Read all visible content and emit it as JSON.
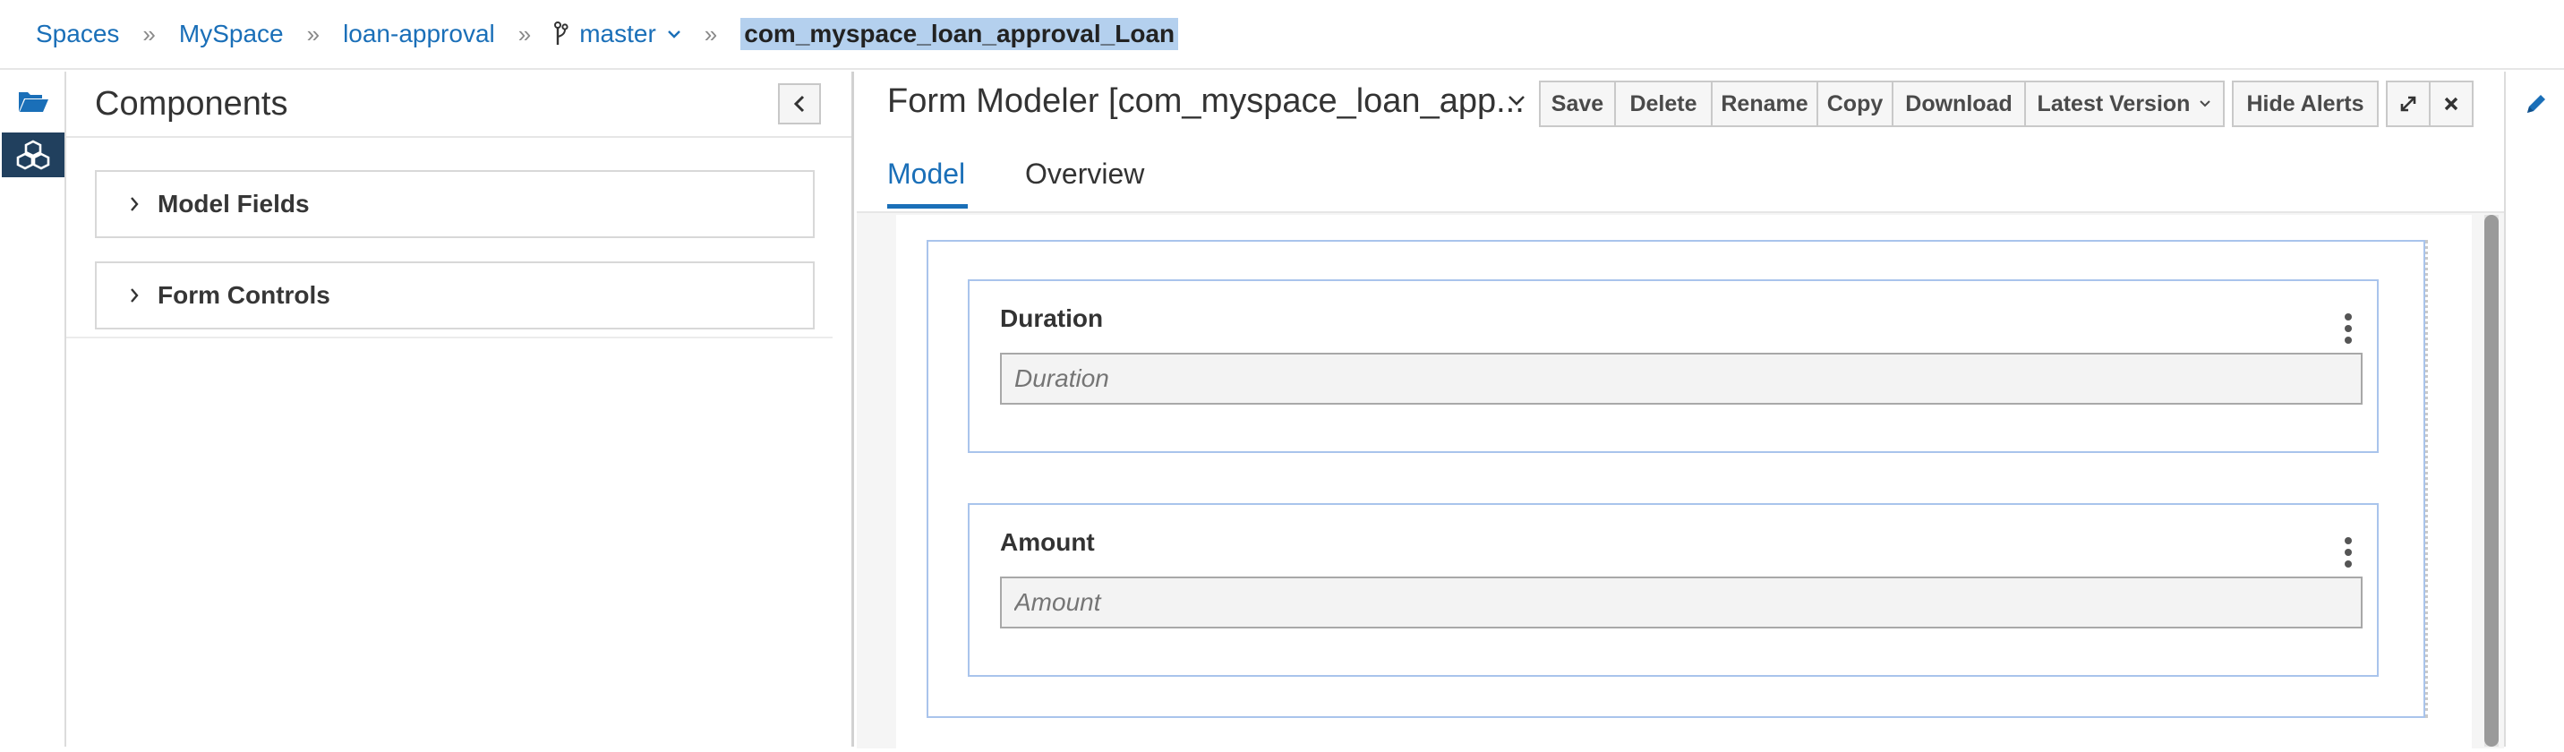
{
  "breadcrumb": {
    "spaces": "Spaces",
    "myspace": "MySpace",
    "project": "loan-approval",
    "branch": "master",
    "current": "com_myspace_loan_approval_Loan"
  },
  "rail": {
    "projects_icon": "folder-open-icon",
    "components_icon": "cubes-icon"
  },
  "components": {
    "title": "Components",
    "sections": [
      "Model Fields",
      "Form Controls"
    ]
  },
  "editor": {
    "title": "Form Modeler [com_myspace_loan_app...",
    "toolbar": {
      "save": "Save",
      "delete": "Delete",
      "rename": "Rename",
      "copy": "Copy",
      "download": "Download",
      "latest_version": "Latest Version",
      "hide_alerts": "Hide Alerts"
    },
    "tabs": [
      "Model",
      "Overview"
    ],
    "active_tab": "Model"
  },
  "form": {
    "fields": [
      {
        "label": "Duration",
        "placeholder": "Duration"
      },
      {
        "label": "Amount",
        "placeholder": "Amount"
      }
    ]
  },
  "colors": {
    "link": "#1a6fb8",
    "rail_active": "#21405e",
    "field_outline": "#a9c4ec",
    "highlight": "#b4d0ee"
  }
}
